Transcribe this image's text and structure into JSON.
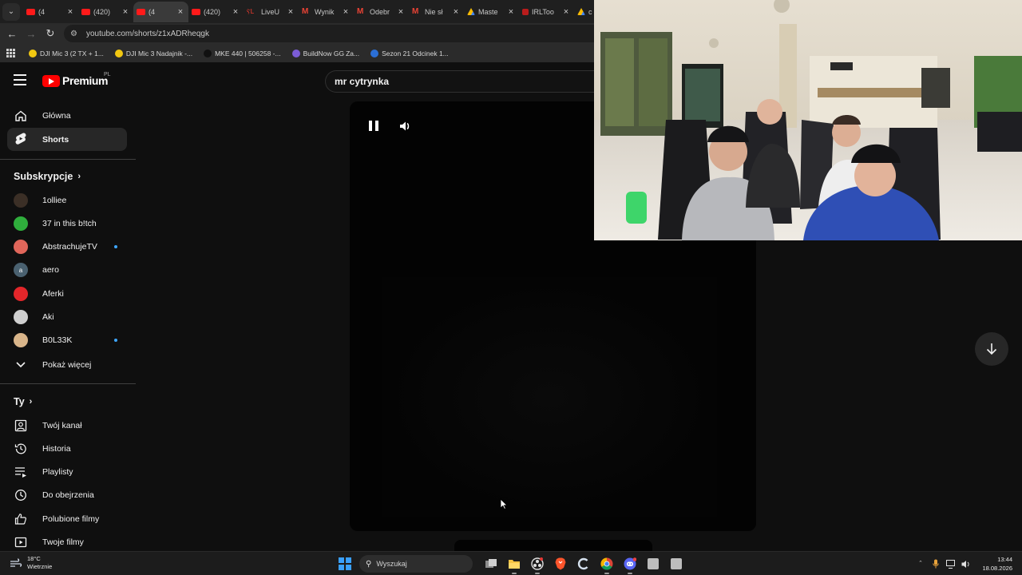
{
  "browser": {
    "tabs": [
      {
        "label": "(4",
        "icon": "youtube-icon",
        "active": false
      },
      {
        "label": "(420)",
        "icon": "youtube-icon",
        "active": false
      },
      {
        "label": "(4",
        "icon": "youtube-icon",
        "active": true
      },
      {
        "label": "(420)",
        "icon": "youtube-icon",
        "active": false
      },
      {
        "label": "LiveU",
        "icon": "liveu-icon",
        "active": false
      },
      {
        "label": "Wynik",
        "icon": "gmail-icon",
        "active": false
      },
      {
        "label": "Odebr",
        "icon": "gmail-icon",
        "active": false
      },
      {
        "label": "Nie sł",
        "icon": "gmail-icon",
        "active": false
      },
      {
        "label": "Maste",
        "icon": "drive-icon",
        "active": false
      },
      {
        "label": "IRLToo",
        "icon": "irltoolkit-icon",
        "active": false
      },
      {
        "label": "c",
        "icon": "drive-icon",
        "active": false
      }
    ],
    "url": "youtube.com/shorts/z1xADRheqgk",
    "bookmarks": [
      {
        "label": "DJI Mic 3 (2 TX + 1...",
        "color": "#f2c811"
      },
      {
        "label": "DJI Mic 3 Nadajnik -...",
        "color": "#f2c811"
      },
      {
        "label": "MKE 440 | 506258 -...",
        "color": "#111111"
      },
      {
        "label": "BuildNow GG",
        "color": "#7b5cd6"
      },
      {
        "label": "Za...",
        "color": ""
      },
      {
        "label": "Sezon 21 Odcinek 1...",
        "color": "#2b6fd6"
      }
    ]
  },
  "youtube": {
    "logo_text": "Premium",
    "country_code": "PL",
    "search_value": "mr cytrynka",
    "nav": [
      {
        "label": "Główna",
        "icon": "home-icon",
        "active": false
      },
      {
        "label": "Shorts",
        "icon": "shorts-icon",
        "active": true
      }
    ],
    "subscriptions_title": "Subskrypcje",
    "subscriptions": [
      {
        "label": "1olliee",
        "avatar_color": "#3b2f26",
        "initial": "",
        "new_content": false
      },
      {
        "label": "37 in this b!tch",
        "avatar_color": "#2fae3c",
        "initial": "",
        "new_content": false
      },
      {
        "label": "AbstrachujeTV",
        "avatar_color": "#e0665a",
        "initial": "",
        "new_content": true
      },
      {
        "label": "aero",
        "avatar_color": "#4a6170",
        "initial": "a",
        "new_content": false
      },
      {
        "label": "Aferki",
        "avatar_color": "#e3262a",
        "initial": "",
        "new_content": false
      },
      {
        "label": "Aki",
        "avatar_color": "#cfcfcf",
        "initial": "",
        "new_content": false
      },
      {
        "label": "B0L33K",
        "avatar_color": "#d9b58a",
        "initial": "",
        "new_content": true
      }
    ],
    "show_more": "Pokaż więcej",
    "you_title": "Ty",
    "you_items": [
      {
        "label": "Twój kanał",
        "icon": "account-box-icon"
      },
      {
        "label": "Historia",
        "icon": "history-icon"
      },
      {
        "label": "Playlisty",
        "icon": "playlist-icon"
      },
      {
        "label": "Do obejrzenia",
        "icon": "watch-later-icon"
      },
      {
        "label": "Polubione filmy",
        "icon": "thumb-up-icon"
      },
      {
        "label": "Twoje filmy",
        "icon": "your-videos-icon"
      }
    ]
  },
  "taskbar": {
    "weather_temp": "18°C",
    "weather_desc": "Wietrznie",
    "search_placeholder": "Wyszukaj",
    "time": "13:44",
    "date": "18.08.2026",
    "pinned_apps": [
      "task-view-icon",
      "file-explorer-icon",
      "obs-icon",
      "brave-icon",
      "ccleaner-icon",
      "chrome-icon",
      "discord-icon",
      "app-icon",
      "app-icon"
    ]
  }
}
